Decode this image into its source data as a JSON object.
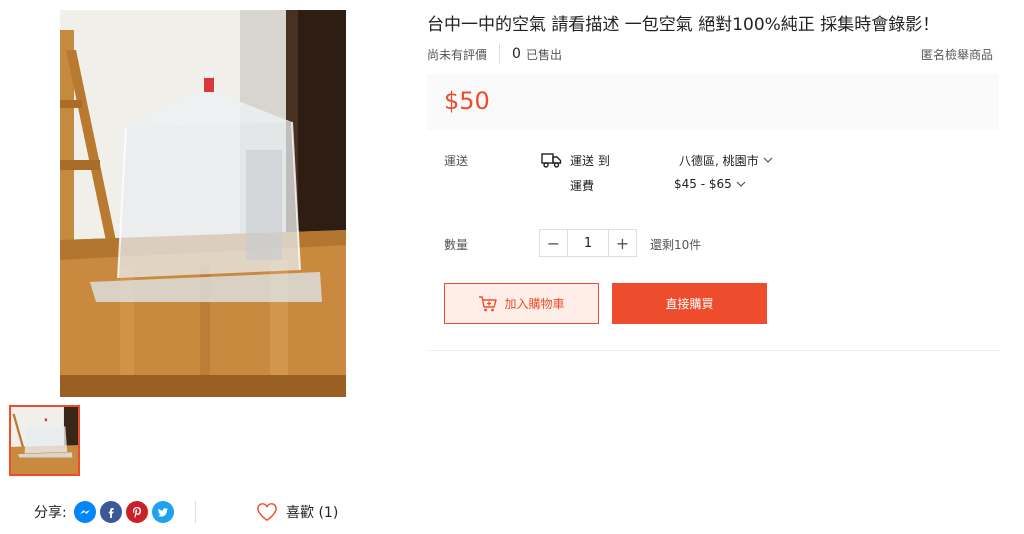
{
  "product": {
    "title": "台中一中的空氣 請看描述 一包空氣 絕對100%純正 採集時會錄影！",
    "rating_text": "尚未有評價",
    "sold_count": "0",
    "sold_label": "已售出",
    "report_label": "匿名檢舉商品",
    "price": "$50",
    "accent_color": "#ee4d2d"
  },
  "shipping": {
    "label": "運送",
    "to_label": "運送 到",
    "location": "八德區, 桃園市",
    "fee_label": "運費",
    "fee_range": "$45 - $65",
    "icon": "truck-icon"
  },
  "quantity": {
    "label": "數量",
    "minus": "−",
    "value": "1",
    "plus": "+",
    "stock_text": "還剩10件"
  },
  "actions": {
    "add_to_cart": "加入購物車",
    "buy_now": "直接購買"
  },
  "social": {
    "share_label": "分享:",
    "icons": [
      "messenger-icon",
      "facebook-icon",
      "pinterest-icon",
      "twitter-icon"
    ],
    "like_label": "喜歡 (1)"
  }
}
